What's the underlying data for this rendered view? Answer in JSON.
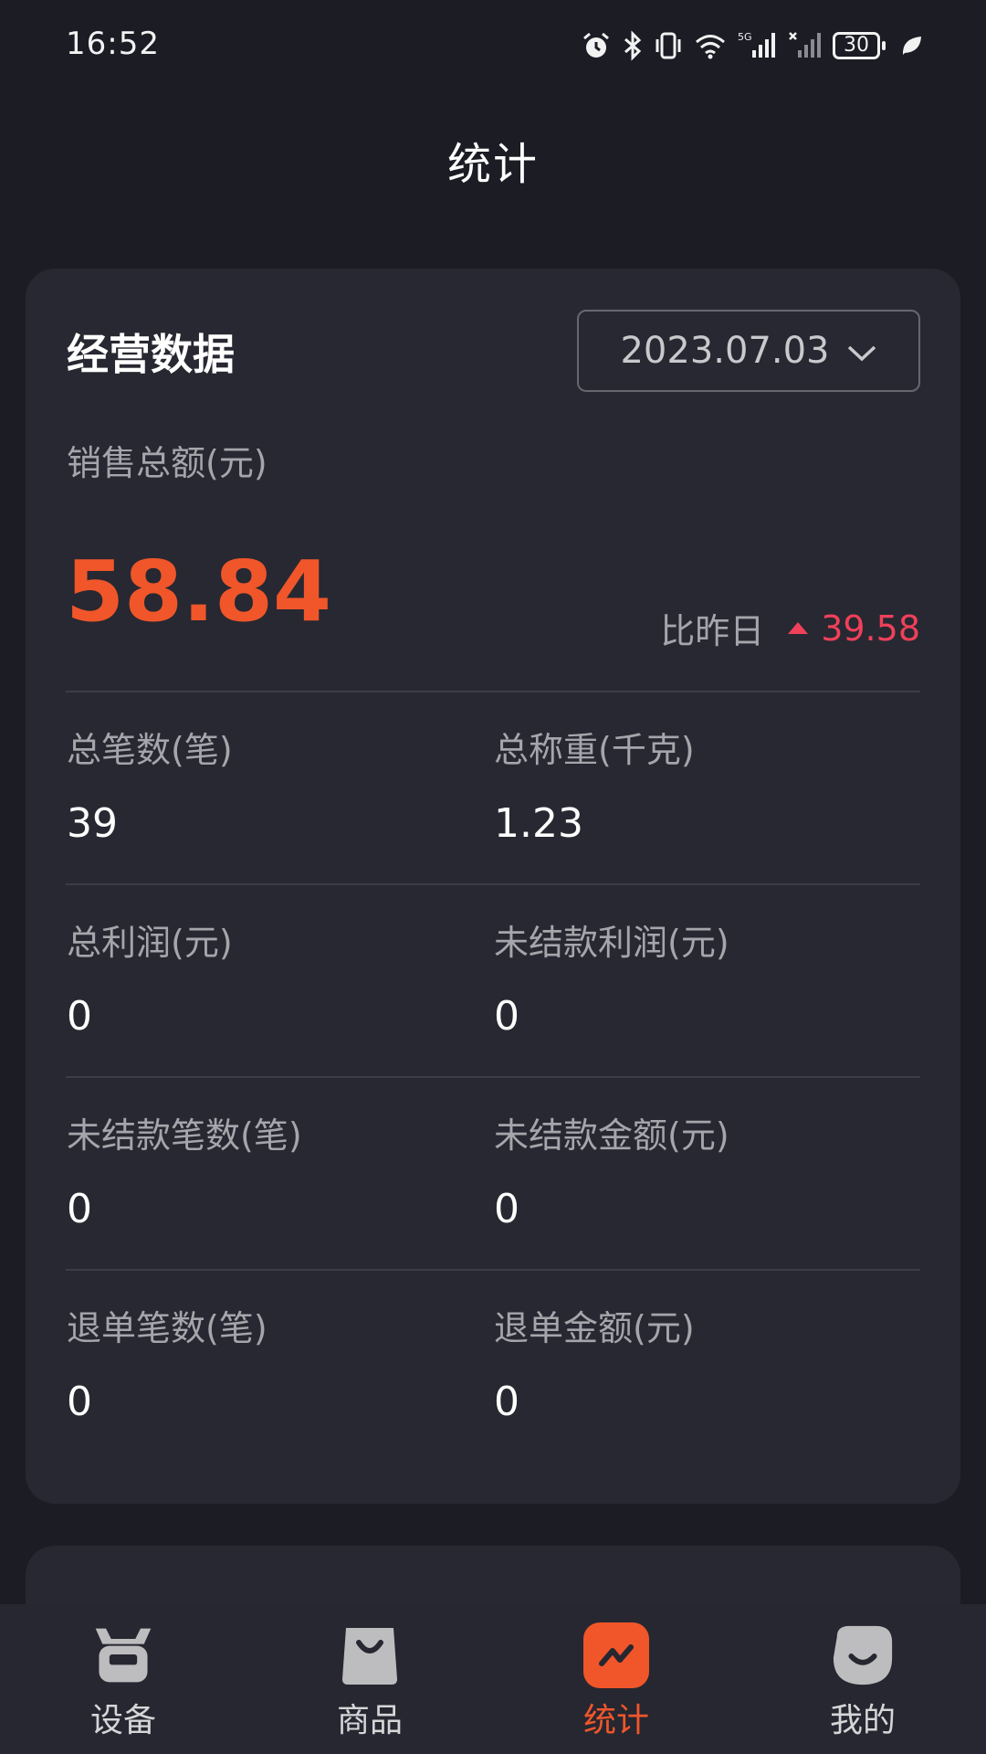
{
  "status_bar": {
    "time": "16:52",
    "battery": "30",
    "icons": [
      "alarm-icon",
      "bluetooth-icon",
      "vibrate-icon",
      "wifi-icon",
      "signal-5g-icon",
      "signal-no-sim-icon",
      "battery-icon",
      "leaf-icon"
    ]
  },
  "header": {
    "title": "统计"
  },
  "business_card": {
    "title": "经营数据",
    "date": "2023.07.03",
    "sales_label": "销售总额(元)",
    "sales_value": "58.84",
    "compare_label": "比昨日",
    "compare_value": "39.58",
    "stats": [
      {
        "label": "总笔数(笔)",
        "value": "39"
      },
      {
        "label": "总称重(千克)",
        "value": "1.23"
      },
      {
        "label": "总利润(元)",
        "value": "0"
      },
      {
        "label": "未结款利润(元)",
        "value": "0"
      },
      {
        "label": "未结款笔数(笔)",
        "value": "0"
      },
      {
        "label": "未结款金额(元)",
        "value": "0"
      },
      {
        "label": "退单笔数(笔)",
        "value": "0"
      },
      {
        "label": "退单金额(元)",
        "value": "0"
      }
    ]
  },
  "bottom_nav": {
    "items": [
      {
        "label": "设备",
        "icon": "scale-device-icon"
      },
      {
        "label": "商品",
        "icon": "shopping-bag-icon"
      },
      {
        "label": "统计",
        "icon": "trend-chart-icon",
        "active": true
      },
      {
        "label": "我的",
        "icon": "smile-profile-icon"
      }
    ]
  },
  "colors": {
    "accent": "#f0562a",
    "increase": "#f0405a",
    "background": "#1b1c24",
    "card": "#272831"
  }
}
